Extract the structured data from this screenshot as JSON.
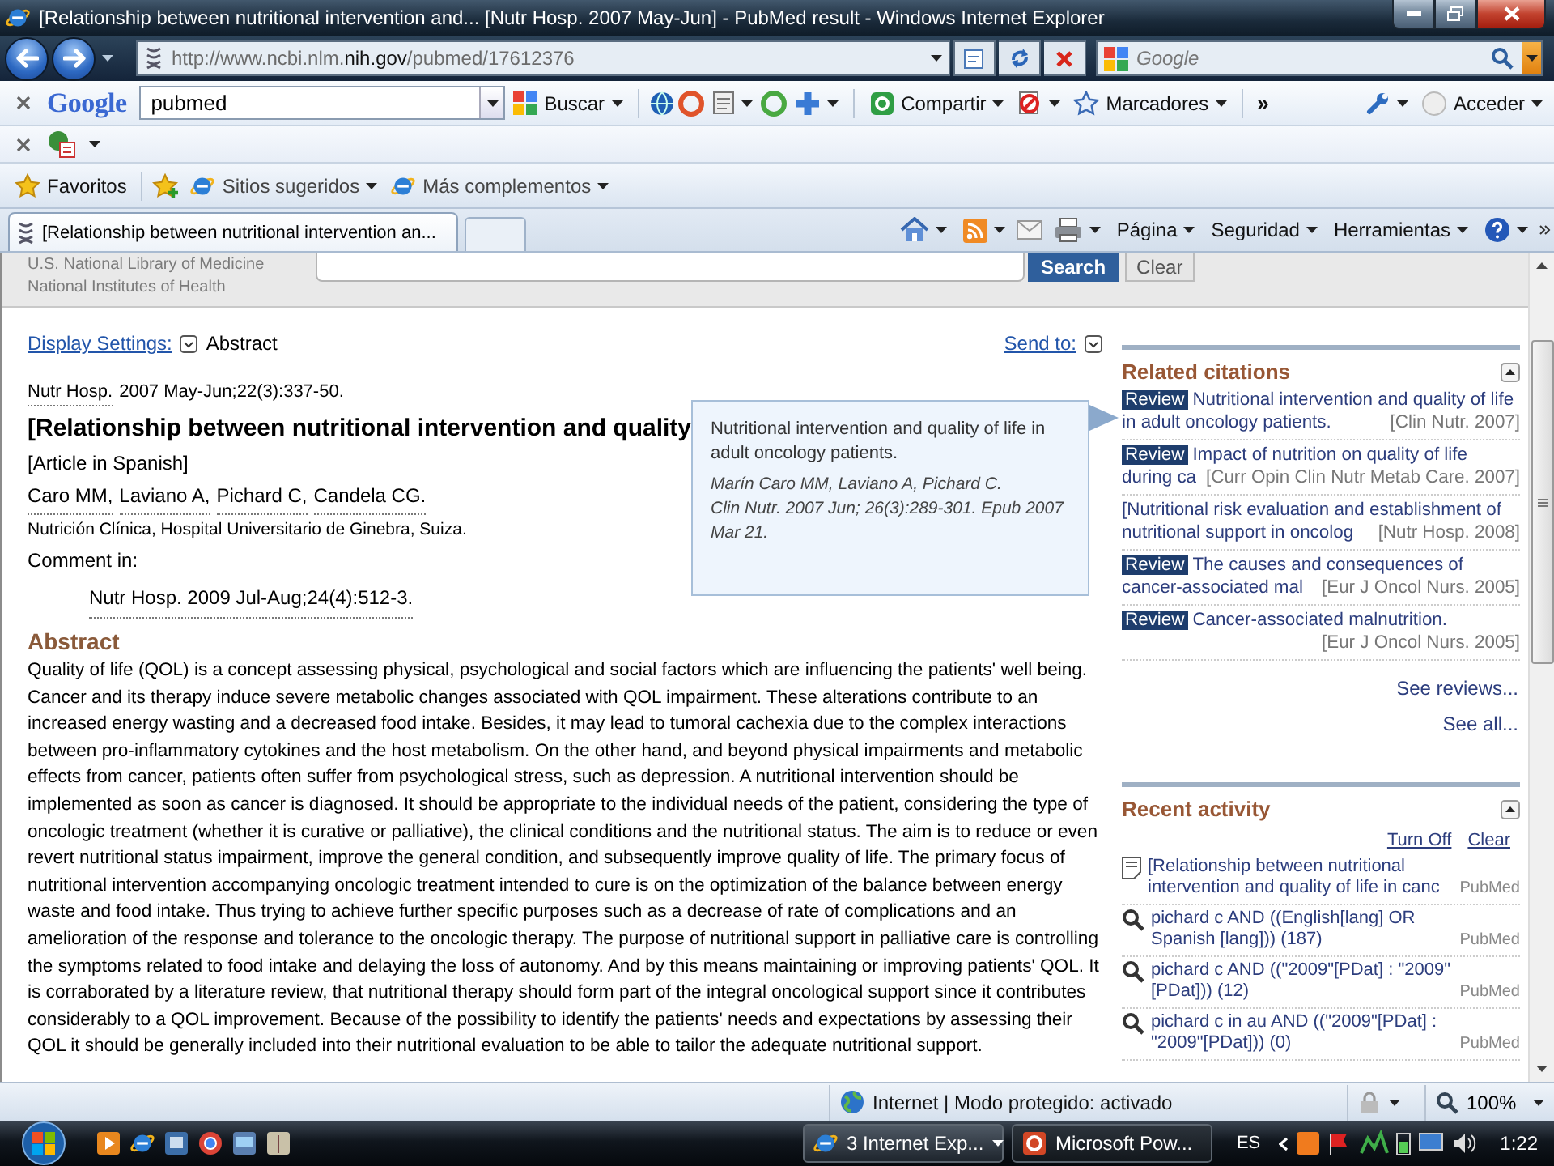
{
  "window": {
    "title": "[Relationship between nutritional intervention and... [Nutr Hosp. 2007 May-Jun] - PubMed result - Windows Internet Explorer"
  },
  "address_bar": {
    "url": "http://www.ncbi.nlm.**nih.gov**/pubmed/17612376",
    "search_placeholder": "Google"
  },
  "google_toolbar": {
    "logo": "Google",
    "query": "pubmed",
    "search_button": "Buscar",
    "share_button": "Compartir",
    "bookmarks_button": "Marcadores",
    "more": "»",
    "sign_in": "Acceder"
  },
  "favorites_bar": {
    "favorites": "Favoritos",
    "links": [
      "Sitios sugeridos",
      "Más complementos"
    ]
  },
  "tabs": [
    {
      "label": "[Relationship between nutritional intervention an...",
      "selected": true
    }
  ],
  "command_bar": [
    "Página",
    "Seguridad",
    "Herramientas"
  ],
  "page": {
    "header": {
      "org_lines": [
        "U.S. National Library of Medicine",
        "National Institutes of Health"
      ],
      "search_button": "Search",
      "clear_button": "Clear"
    },
    "display_settings": "Display Settings:",
    "format": "Abstract",
    "send_to": "Send to:",
    "citation": {
      "journal": "Nutr Hosp.",
      "details": "2007 May-Jun;22(3):337-50."
    },
    "title": "[Relationship between nutritional intervention and quality",
    "language": "[Article in Spanish]",
    "authors": [
      "Caro MM,",
      "Laviano A,",
      "Pichard C,",
      "Candela CG."
    ],
    "affiliation": "Nutrición Clínica, Hospital Universitario de Ginebra, Suiza.",
    "comment_label": "Comment in:",
    "comment_link": "Nutr Hosp. 2009 Jul-Aug;24(4):512-3.",
    "abstract_heading": "Abstract",
    "abstract": "Quality of life (QOL) is a concept assessing physical, psychological and social factors which are influencing the patients' well being. Cancer and its therapy induce severe metabolic changes associated with QOL impairment. These alterations contribute to an increased energy wasting and a decreased food intake. Besides, it may lead to tumoral cachexia due to the complex interactions between pro-inflammatory cytokines and the host metabolism. On the other hand, and beyond physical impairments and metabolic effects from cancer, patients often suffer from psychological stress, such as depression. A nutritional intervention should be implemented as soon as cancer is diagnosed. It should be appropriate to the individual needs of the patient, considering the type of oncologic treatment (whether it is curative or palliative), the clinical conditions and the nutritional status. The aim is to reduce or even revert nutritional status impairment, improve the general condition, and subsequently improve quality of life. The primary focus of nutritional intervention accompanying oncologic treatment intended to cure is on the optimization of the balance between energy waste and food intake. Thus trying to achieve further specific purposes such as a decrease of rate of complications and an amelioration of the response and tolerance to the oncologic therapy. The purpose of nutritional support in palliative care is controlling the symptoms related to food intake and delaying the loss of autonomy. And by this means maintaining or improving patients' QOL. It is corraborated by a literature review, that nutritional therapy should form part of the integral oncological support since it contributes considerably to a QOL improvement. Because of the possibility to identify the patients' needs and expectations by assessing their QOL it should be generally included into their nutritional evaluation to be able to tailor the adequate nutritional support.",
    "tooltip": {
      "title": "Nutritional intervention and quality of life in adult oncology patients.",
      "authors": "Marín Caro MM, Laviano A, Pichard C.",
      "source": "Clin Nutr. 2007 Jun; 26(3):289-301. Epub 2007 Mar 21."
    }
  },
  "related": {
    "heading": "Related citations",
    "items": [
      {
        "badge": "Review",
        "title": "Nutritional intervention and quality of life in adult oncology patients.",
        "journal": "[Clin Nutr. 2007]"
      },
      {
        "badge": "Review",
        "title": "Impact of nutrition on quality of life during ca",
        "journal": "[Curr Opin Clin Nutr Metab Care. 2007]"
      },
      {
        "title": "[Nutritional risk evaluation and establishment of nutritional support in oncolog",
        "journal": "[Nutr Hosp. 2008]"
      },
      {
        "badge": "Review",
        "title": "The causes and consequences of cancer-associated mal",
        "journal": "[Eur J Oncol Nurs. 2005]"
      },
      {
        "badge": "Review",
        "title": "Cancer-associated malnutrition.",
        "journal": "[Eur J Oncol Nurs. 2005]"
      }
    ],
    "links": [
      "See reviews...",
      "See all..."
    ]
  },
  "recent": {
    "heading": "Recent activity",
    "actions": [
      "Turn Off",
      "Clear"
    ],
    "items": [
      {
        "kind": "document",
        "text": "[Relationship between nutritional intervention and quality of life in canc",
        "source": "PubMed"
      },
      {
        "kind": "search",
        "text": "pichard c AND ((English[lang] OR Spanish [lang])) (187)",
        "source": "PubMed"
      },
      {
        "kind": "search",
        "text": "pichard c AND ((\"2009\"[PDat] : \"2009\"[PDat])) (12)",
        "source": "PubMed"
      },
      {
        "kind": "search",
        "text": "pichard c in au AND ((\"2009\"[PDat] : \"2009\"[PDat])) (0)",
        "source": "PubMed"
      }
    ]
  },
  "status_bar": {
    "zone": "Internet | Modo protegido: activado",
    "zoom": "100%"
  },
  "taskbar": {
    "windows": [
      {
        "kind": "browser",
        "label": "3 Internet Exp...",
        "selected": true
      },
      {
        "kind": "slides",
        "label": "Microsoft Pow...",
        "selected": false
      }
    ],
    "language": "ES",
    "clock": "1:22"
  }
}
